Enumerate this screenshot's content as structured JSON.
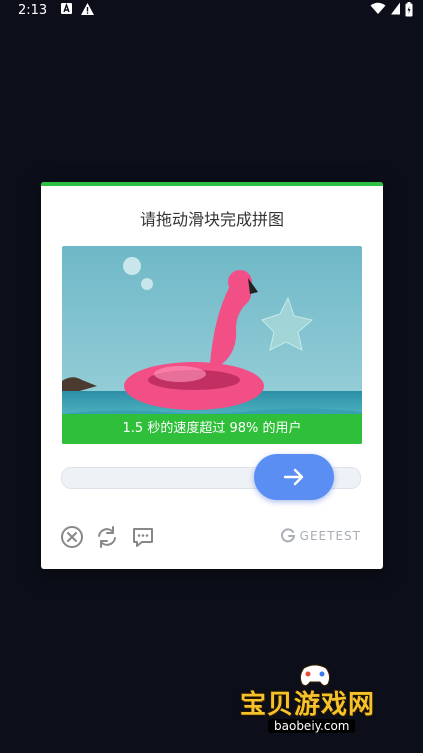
{
  "status_bar": {
    "time": "2:13"
  },
  "captcha": {
    "title": "请拖动滑块完成拼图",
    "result_message": "1.5 秒的速度超过 98% 的用户",
    "brand": "GEETEST",
    "icons": [
      "close-icon",
      "refresh-icon",
      "feedback-icon",
      "arrow-right-icon"
    ]
  },
  "watermark": {
    "title": "宝贝游戏网",
    "url": "baobeiy.com"
  },
  "colors": {
    "success": "#2fbf3a",
    "slider": "#5b8ef3"
  }
}
